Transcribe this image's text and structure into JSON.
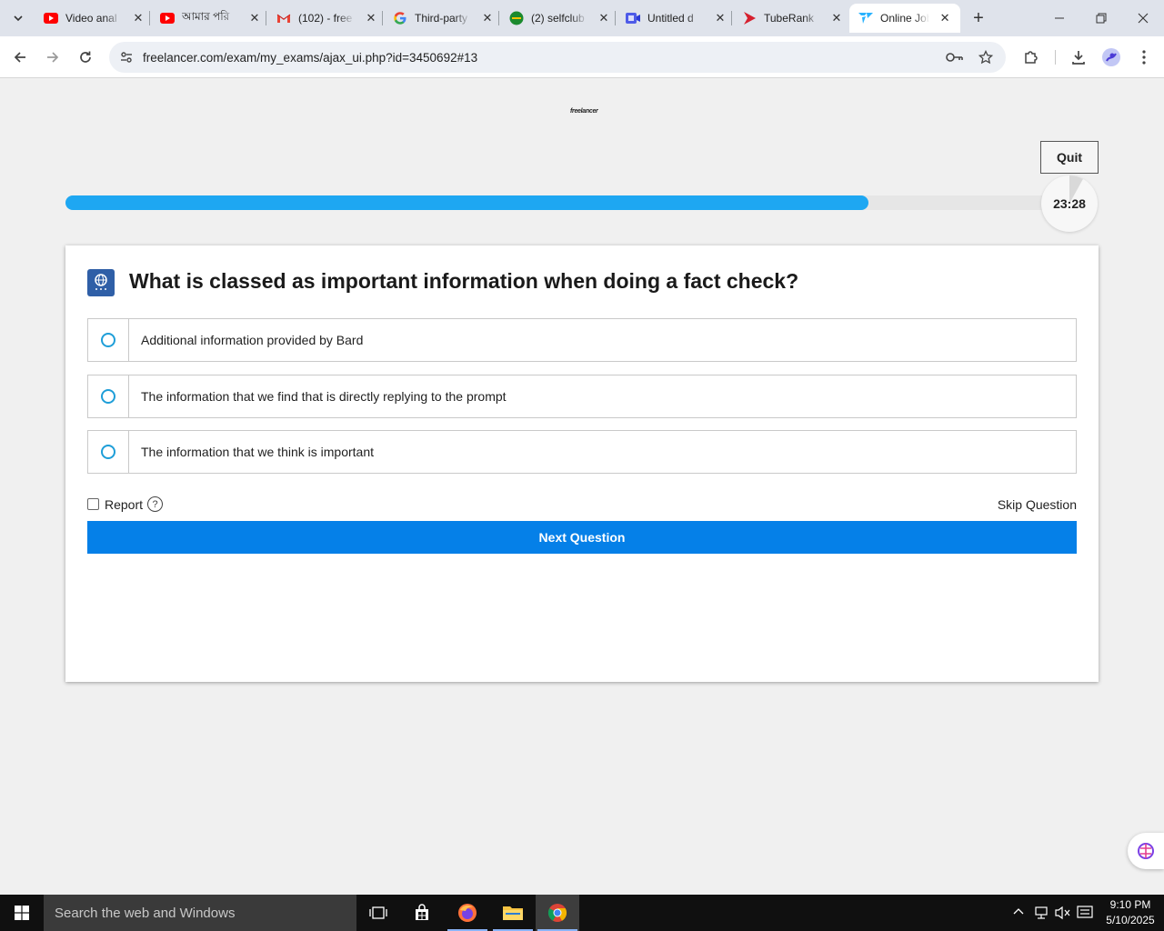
{
  "browser": {
    "tabs": [
      {
        "title": "Video anal",
        "icon": "youtube-icon"
      },
      {
        "title": "আমার পরি",
        "icon": "youtube-icon"
      },
      {
        "title": "(102) - free",
        "icon": "gmail-icon"
      },
      {
        "title": "Third-party",
        "icon": "google-icon"
      },
      {
        "title": "(2) selfclub",
        "icon": "selfclub-icon"
      },
      {
        "title": "Untitled d",
        "icon": "video-doc-icon"
      },
      {
        "title": "TubeRank",
        "icon": "tuberank-icon"
      },
      {
        "title": "Online Job",
        "icon": "freelancer-icon",
        "active": true
      }
    ],
    "url": "freelancer.com/exam/my_exams/ajax_ui.php?id=3450692#13"
  },
  "page": {
    "logo_text": "freelancer",
    "quit_label": "Quit",
    "progress_fraction": 0.81,
    "timer": "23:28",
    "timer_fraction": 0.08,
    "question": "What is classed as important information when doing a fact check?",
    "options": [
      {
        "text": "Additional information provided by Bard"
      },
      {
        "text": "The information that we find that is directly replying to the prompt"
      },
      {
        "text": "The information that we think is important"
      }
    ],
    "report_label": "Report",
    "skip_label": "Skip Question",
    "next_label": "Next Question"
  },
  "taskbar": {
    "search_placeholder": "Search the web and Windows",
    "time": "9:10 PM",
    "date": "5/10/2025"
  },
  "colors": {
    "progress": "#1ea7f2",
    "next_button": "#0580e8",
    "radio": "#1e9ed8"
  }
}
